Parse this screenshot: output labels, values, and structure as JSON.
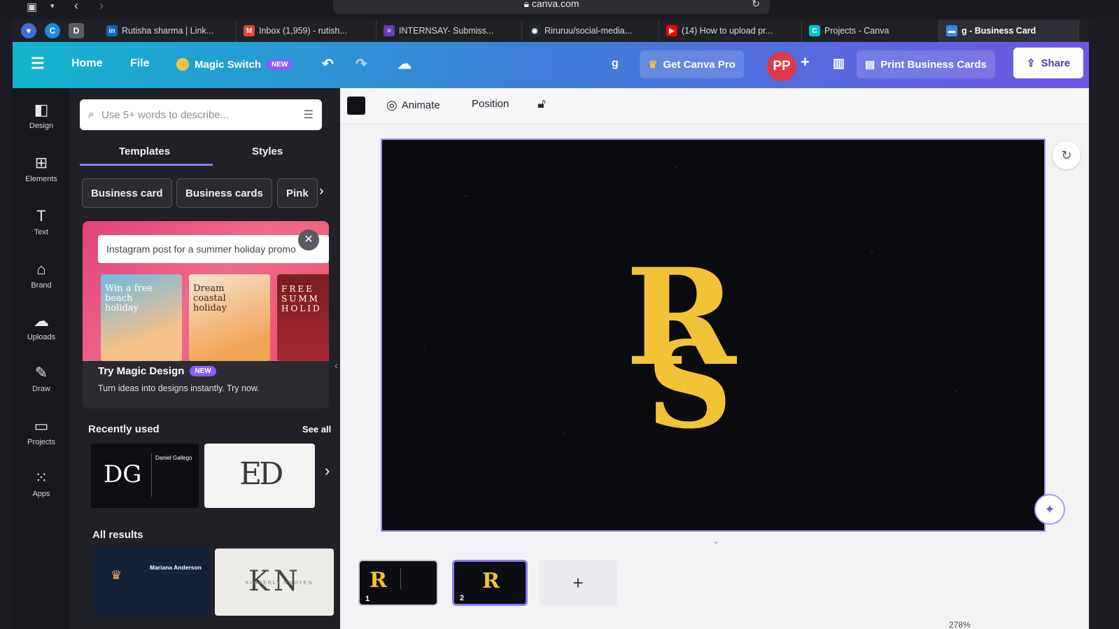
{
  "browser": {
    "url": "canva.com",
    "tabs": [
      {
        "label": "Rutisha sharma | Link...",
        "icon": "linkedin-icon",
        "color": "#0a66c2",
        "glyph": "in"
      },
      {
        "label": "Inbox (1,959) - rutish...",
        "icon": "gmail-icon",
        "color": "#ea4335",
        "glyph": "M"
      },
      {
        "label": "INTERNSAY- Submiss...",
        "icon": "forms-icon",
        "color": "#673ab7",
        "glyph": "≡"
      },
      {
        "label": "Riruruu/social-media...",
        "icon": "github-icon",
        "color": "#24292e",
        "glyph": "◉"
      },
      {
        "label": "(14) How to upload pr...",
        "icon": "youtube-icon",
        "color": "#ff0000",
        "glyph": "▶"
      },
      {
        "label": "Projects - Canva",
        "icon": "canva-icon",
        "color": "#00c4cc",
        "glyph": "C"
      },
      {
        "label": "g - Business Card",
        "icon": "canva-doc-icon",
        "color": "#3f86e8",
        "glyph": "▬"
      }
    ]
  },
  "topbar": {
    "home": "Home",
    "file": "File",
    "magic_switch": "Magic Switch",
    "new_badge": "NEW",
    "doc_initial": "g",
    "get_pro": "Get Canva Pro",
    "avatar": "PP",
    "print": "Print Business Cards",
    "share": "Share"
  },
  "rail": [
    {
      "label": "Design",
      "icon": "design-icon",
      "glyph": "◧"
    },
    {
      "label": "Elements",
      "icon": "elements-icon",
      "glyph": "⊞"
    },
    {
      "label": "Text",
      "icon": "text-icon",
      "glyph": "T"
    },
    {
      "label": "Brand",
      "icon": "brand-icon",
      "glyph": "⌂"
    },
    {
      "label": "Uploads",
      "icon": "uploads-icon",
      "glyph": "☁"
    },
    {
      "label": "Draw",
      "icon": "draw-icon",
      "glyph": "✎"
    },
    {
      "label": "Projects",
      "icon": "projects-icon",
      "glyph": "▭"
    },
    {
      "label": "Apps",
      "icon": "apps-icon",
      "glyph": "⁙"
    }
  ],
  "panel": {
    "search_placeholder": "Use 5+ words to describe...",
    "tabs": [
      "Templates",
      "Styles"
    ],
    "chips": [
      "Business card",
      "Business cards",
      "Pink"
    ],
    "magic": {
      "prompt": "Instagram post for a summer holiday promo",
      "thumb1": "Win a free beach holiday",
      "thumb2": "Dream coastal holiday",
      "thumb3": "FREE SUMM HOLID",
      "title": "Try Magic Design",
      "badge": "NEW",
      "subtitle": "Turn ideas into designs instantly. Try now."
    },
    "recent_title": "Recently used",
    "see_all": "See all",
    "recent": [
      {
        "monogram": "DG",
        "name": "Daniel Gallego"
      },
      {
        "monogram": "ED",
        "name": ""
      }
    ],
    "all_results": "All results",
    "results": [
      {
        "name": "Mariana Anderson"
      },
      {
        "monogram": "KN",
        "name": "KIMBERLY NGUYEN"
      }
    ]
  },
  "editor": {
    "animate": "Animate",
    "position": "Position",
    "logo_top": "R",
    "logo_bottom": "S",
    "logo_color": "#f2c237",
    "pages": [
      "1",
      "2"
    ],
    "add_page": "+",
    "zoom": "278%"
  }
}
